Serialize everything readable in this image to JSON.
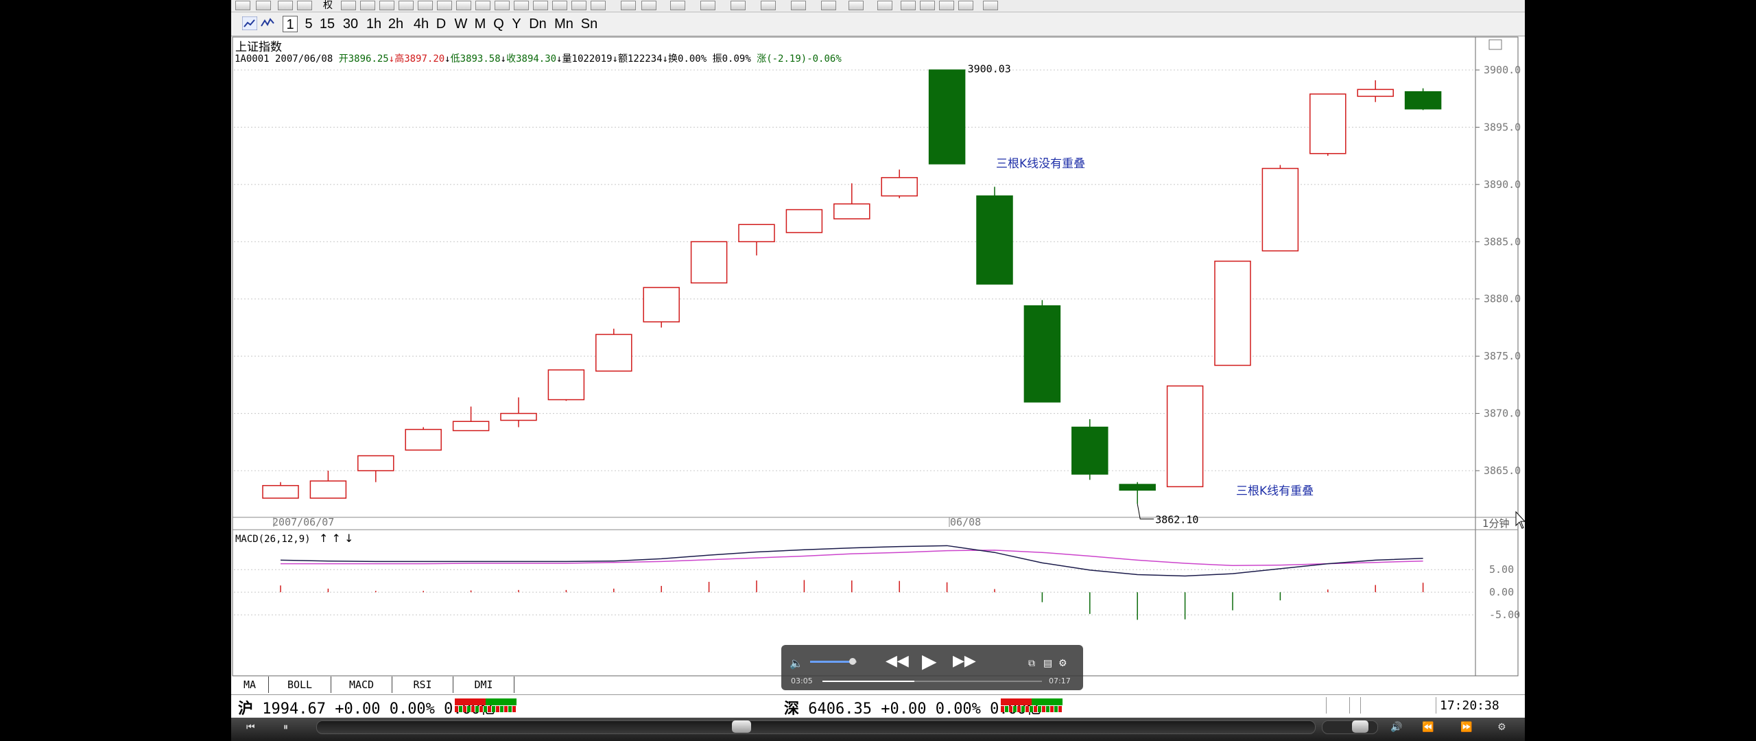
{
  "toolbar": {
    "period_buttons": [
      "1",
      "5",
      "15",
      "30",
      "1h",
      "2h",
      "4h",
      "D",
      "W",
      "M",
      "Q",
      "Y",
      "Dn",
      "Mn",
      "Sn"
    ],
    "menu_label": "权"
  },
  "header": {
    "index_name": "上证指数",
    "info_code_date": "1A0001 2007/06/08",
    "open_label": "开",
    "open_value": "3896.25",
    "high_label": "高",
    "high_value": "3897.20",
    "low_label": "低",
    "low_value": "3893.58",
    "close_label": "收",
    "close_value": "3894.30",
    "volume_label": "量",
    "volume_value": "1022019",
    "amount_label": "额",
    "amount_value": "122234",
    "turnover_label": "换",
    "turnover_value": "0.00%",
    "amplitude_label": "振",
    "amplitude_value": "0.09%",
    "change_label": "涨",
    "change_value": "(-2.19)-0.06%"
  },
  "annotations": {
    "high_marker": "3900.03",
    "low_marker": "3862.10",
    "note_no_overlap": "三根K线没有重叠",
    "note_overlap": "三根K线有重叠"
  },
  "x_axis": {
    "date_left": "2007/06/07",
    "date_mid": "06/08",
    "period": "1分钟"
  },
  "price_axis": {
    "ticks": [
      "3900.0",
      "3895.0",
      "3890.0",
      "3885.0",
      "3880.0",
      "3875.0",
      "3870.0",
      "3865.0"
    ]
  },
  "macd_panel": {
    "title": "MACD(26,12,9)",
    "ticks": [
      "5.00",
      "0.00",
      "-5.00"
    ]
  },
  "indicator_tabs": [
    "MA",
    "BOLL",
    "MACD",
    "RSI",
    "DMI"
  ],
  "status": {
    "sh_label": "沪",
    "sh_text": "1994.67 +0.00 0.00% 0.00亿",
    "sz_label": "深",
    "sz_text": "6406.35 +0.00 0.00% 0.00亿",
    "time": "17:20:38"
  },
  "player": {
    "current_time": "03:05",
    "total_time": "07:17",
    "progress": 0.42,
    "volume": 0.6
  },
  "colors": {
    "up": "#d11a1a",
    "down": "#0a6a0a",
    "dif": "#1a1a4a",
    "dea": "#cc44cc",
    "grid": "#c8c8c8",
    "note": "#1e2fa8"
  },
  "chart_data": {
    "type": "candlestick",
    "title": "上证指数",
    "candles": [
      {
        "o": 3862.6,
        "h": 3864.0,
        "l": 3862.6,
        "c": 3863.7
      },
      {
        "o": 3862.6,
        "h": 3865.0,
        "l": 3862.6,
        "c": 3864.1
      },
      {
        "o": 3865.0,
        "h": 3866.3,
        "l": 3864.0,
        "c": 3866.3
      },
      {
        "o": 3866.8,
        "h": 3868.8,
        "l": 3866.8,
        "c": 3868.6
      },
      {
        "o": 3868.5,
        "h": 3870.6,
        "l": 3868.5,
        "c": 3869.3
      },
      {
        "o": 3869.4,
        "h": 3871.4,
        "l": 3868.8,
        "c": 3870.0
      },
      {
        "o": 3871.2,
        "h": 3873.8,
        "l": 3871.1,
        "c": 3873.8
      },
      {
        "o": 3873.7,
        "h": 3877.4,
        "l": 3873.7,
        "c": 3876.9
      },
      {
        "o": 3878.0,
        "h": 3881.0,
        "l": 3877.5,
        "c": 3881.0
      },
      {
        "o": 3881.4,
        "h": 3885.0,
        "l": 3881.4,
        "c": 3885.0
      },
      {
        "o": 3885.0,
        "h": 3886.5,
        "l": 3883.8,
        "c": 3886.5
      },
      {
        "o": 3885.8,
        "h": 3887.8,
        "l": 3885.8,
        "c": 3887.8
      },
      {
        "o": 3887.0,
        "h": 3890.1,
        "l": 3887.0,
        "c": 3888.3
      },
      {
        "o": 3889.0,
        "h": 3891.3,
        "l": 3888.8,
        "c": 3890.6
      },
      {
        "o": 3900.0,
        "h": 3900.03,
        "l": 3891.8,
        "c": 3891.8
      },
      {
        "o": 3889.0,
        "h": 3889.8,
        "l": 3881.3,
        "c": 3881.3
      },
      {
        "o": 3879.4,
        "h": 3879.9,
        "l": 3871.0,
        "c": 3871.0
      },
      {
        "o": 3868.8,
        "h": 3869.5,
        "l": 3864.2,
        "c": 3864.7
      },
      {
        "o": 3863.8,
        "h": 3864.0,
        "l": 3862.1,
        "c": 3863.3
      },
      {
        "o": 3863.6,
        "h": 3872.4,
        "l": 3863.6,
        "c": 3872.4
      },
      {
        "o": 3874.2,
        "h": 3883.3,
        "l": 3874.2,
        "c": 3883.3
      },
      {
        "o": 3884.2,
        "h": 3891.7,
        "l": 3884.2,
        "c": 3891.4
      },
      {
        "o": 3892.7,
        "h": 3897.9,
        "l": 3892.5,
        "c": 3897.9
      },
      {
        "o": 3897.7,
        "h": 3899.1,
        "l": 3897.2,
        "c": 3898.3
      },
      {
        "o": 3898.1,
        "h": 3898.4,
        "l": 3896.5,
        "c": 3896.6
      }
    ],
    "y_range": [
      3861.5,
      3900.5
    ],
    "macd": {
      "dif": [
        7.1,
        6.9,
        6.8,
        6.8,
        6.8,
        6.8,
        6.8,
        6.9,
        7.4,
        8.2,
        8.9,
        9.4,
        9.8,
        10.1,
        10.3,
        8.8,
        6.5,
        4.9,
        3.9,
        3.6,
        4.1,
        5.2,
        6.3,
        7.1,
        7.5
      ],
      "dea": [
        6.3,
        6.3,
        6.3,
        6.3,
        6.4,
        6.4,
        6.4,
        6.6,
        6.8,
        7.2,
        7.6,
        8.0,
        8.5,
        8.8,
        9.2,
        9.3,
        8.8,
        8.0,
        7.1,
        6.4,
        5.9,
        6.0,
        6.3,
        6.6,
        6.9
      ],
      "hist": [
        1.5,
        0.8,
        0.3,
        0.3,
        0.4,
        0.5,
        0.5,
        0.8,
        1.4,
        2.3,
        2.6,
        2.7,
        2.6,
        2.5,
        2.2,
        0.7,
        -2.2,
        -4.8,
        -6.1,
        -6.0,
        -4.0,
        -1.8,
        0.6,
        1.6,
        2.1
      ],
      "y_range": [
        -6.5,
        10.5
      ]
    }
  }
}
